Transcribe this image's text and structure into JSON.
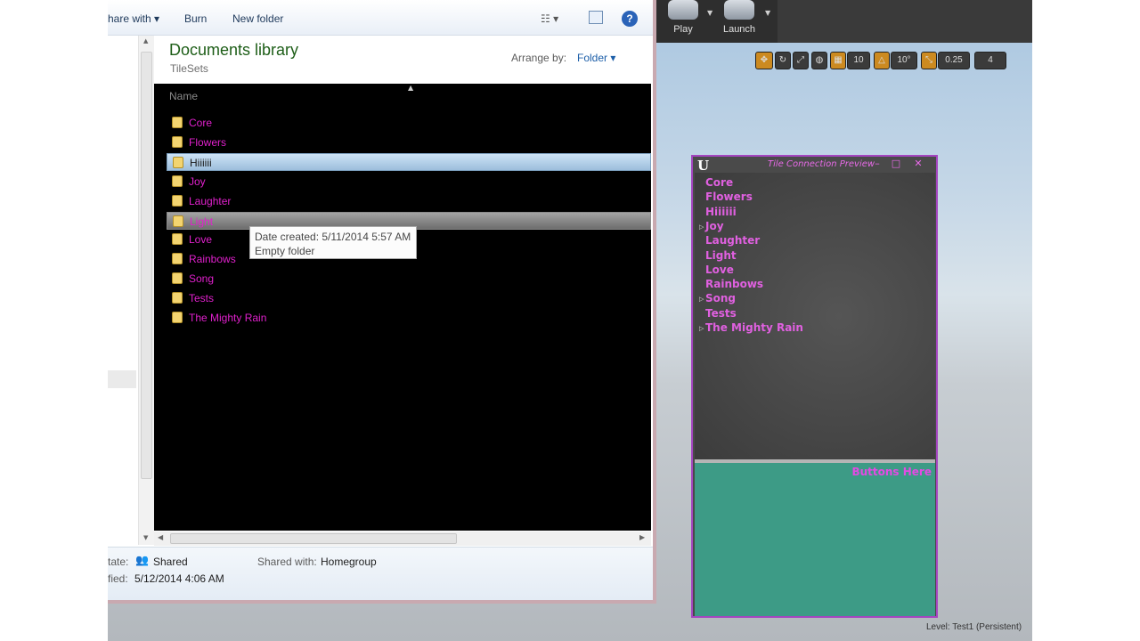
{
  "explorer": {
    "toolbar": {
      "share_with": "hare with",
      "burn": "Burn",
      "new_folder": "New folder"
    },
    "library": {
      "title": "Documents library",
      "subtitle": "TileSets",
      "arrange_by_label": "Arrange by:",
      "arrange_by_value": "Folder"
    },
    "column_name": "Name",
    "files": [
      {
        "name": "Core"
      },
      {
        "name": "Flowers"
      },
      {
        "name": "Hiiiiii"
      },
      {
        "name": "Joy"
      },
      {
        "name": "Laughter"
      },
      {
        "name": "Light"
      },
      {
        "name": "Love"
      },
      {
        "name": "Rainbows"
      },
      {
        "name": "Song"
      },
      {
        "name": "Tests"
      },
      {
        "name": "The Mighty Rain"
      }
    ],
    "selected_file": "Hiiiiii",
    "hovered_file": "Light",
    "tooltip": {
      "line1": "Date created: 5/11/2014 5:57 AM",
      "line2": "Empty folder"
    },
    "details": {
      "state_label": "tate:",
      "state_value": "Shared",
      "shared_with_label": "Shared with:",
      "shared_with_value": "Homegroup",
      "modified_label": "fied:",
      "modified_value": "5/12/2014 4:06 AM"
    }
  },
  "unreal": {
    "toolbar": {
      "play": "Play",
      "launch": "Launch"
    },
    "viewport_toolbar": {
      "grid_size": "10",
      "rotation_snap": "10°",
      "scale_snap": "0.25",
      "camera_speed": "4"
    },
    "level_label": "Level:",
    "level_value": "Test1 (Persistent)"
  },
  "panel": {
    "logo": "U",
    "title": "Tile Connection Preview",
    "items": [
      {
        "label": "Core",
        "expandable": false
      },
      {
        "label": "Flowers",
        "expandable": false
      },
      {
        "label": "Hiiiiii",
        "expandable": false
      },
      {
        "label": "Joy",
        "expandable": true
      },
      {
        "label": "Laughter",
        "expandable": false
      },
      {
        "label": "Light",
        "expandable": false
      },
      {
        "label": "Love",
        "expandable": false
      },
      {
        "label": "Rainbows",
        "expandable": false
      },
      {
        "label": "Song",
        "expandable": true
      },
      {
        "label": "Tests",
        "expandable": false
      },
      {
        "label": "The Mighty Rain",
        "expandable": true
      }
    ],
    "bottom_label": "Buttons Here",
    "colors": {
      "border": "#a445c0",
      "item_text": "#e060e0",
      "bottom_bg": "#3d9b86"
    }
  }
}
